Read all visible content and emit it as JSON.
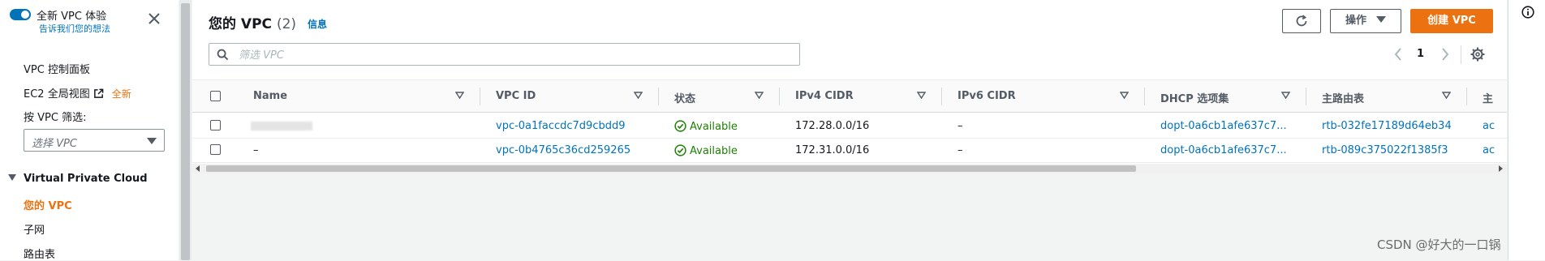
{
  "sidebar": {
    "new_experience_title": "全新 VPC 体验",
    "new_experience_link": "告诉我们您的想法",
    "vpc_dashboard": "VPC 控制面板",
    "ec2_global_view": "EC2 全局视图",
    "new_badge": "全新",
    "filter_label": "按 VPC 筛选:",
    "filter_placeholder": "选择 VPC",
    "section_title": "Virtual Private Cloud",
    "items": [
      {
        "label": "您的 VPC",
        "active": true
      },
      {
        "label": "子网",
        "active": false
      },
      {
        "label": "路由表",
        "active": false
      }
    ]
  },
  "header": {
    "title": "您的 VPC",
    "count": "(2)",
    "info_link": "信息",
    "actions_label": "操作",
    "create_label": "创建 VPC"
  },
  "search": {
    "placeholder": "筛选 VPC",
    "value": ""
  },
  "pagination": {
    "current_page": "1"
  },
  "table": {
    "columns": [
      "Name",
      "VPC ID",
      "状态",
      "IPv4 CIDR",
      "IPv6 CIDR",
      "DHCP 选项集",
      "主路由表",
      "主"
    ],
    "rows": [
      {
        "name": "",
        "vpc_id": "vpc-0a1faccdc7d9cbdd9",
        "status": "Available",
        "ipv4": "172.28.0.0/16",
        "ipv6": "–",
        "dhcp": "dopt-0a6cb1afe637c7...",
        "route_table": "rtb-032fe17189d64eb34",
        "extra": "ac"
      },
      {
        "name": "–",
        "vpc_id": "vpc-0b4765c36cd259265",
        "status": "Available",
        "ipv4": "172.31.0.0/16",
        "ipv6": "–",
        "dhcp": "dopt-0a6cb1afe637c7...",
        "route_table": "rtb-089c375022f1385f3",
        "extra": "ac"
      }
    ]
  },
  "watermark": "CSDN @好大的一口锅",
  "colors": {
    "accent": "#ec7211",
    "link": "#0073bb",
    "success": "#1d8102"
  },
  "icons": [
    "toggle-icon",
    "close-icon",
    "external-link-icon",
    "search-icon",
    "refresh-icon",
    "chevron-left-icon",
    "chevron-right-icon",
    "gear-icon",
    "sort-icon",
    "check-circle-icon",
    "info-icon"
  ]
}
